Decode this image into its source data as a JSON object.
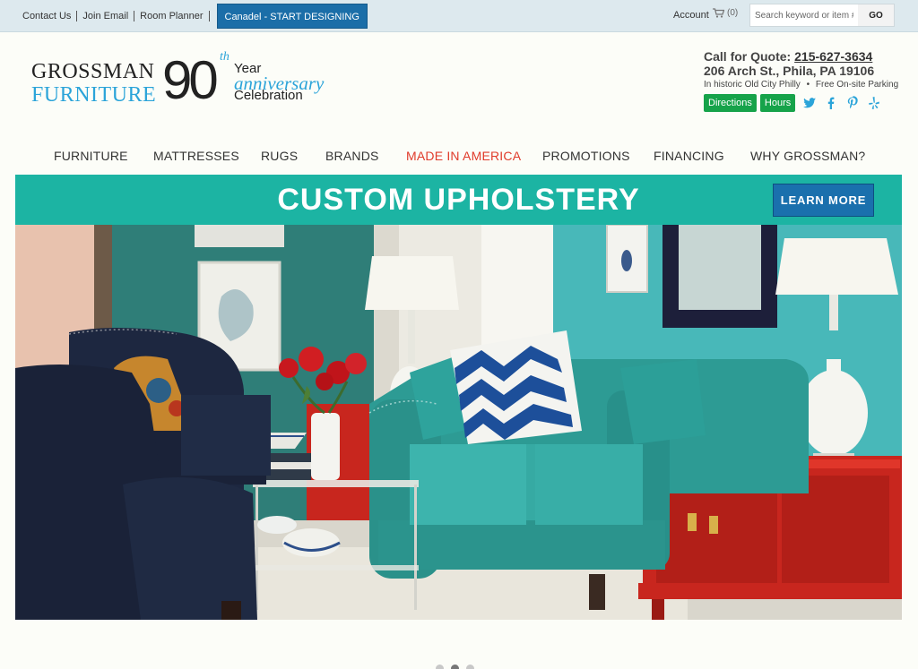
{
  "topbar": {
    "links": [
      "Contact Us",
      "Join Email",
      "Room Planner"
    ],
    "canadel_button": "Canadel - START DESIGNING",
    "account": "Account",
    "cart_count": "(0)",
    "search_placeholder": "Search keyword or item #",
    "go_label": "GO"
  },
  "logo": {
    "line1": "GROSSMAN",
    "line2": "FURNITURE",
    "number": "90",
    "th": "th",
    "year": "Year",
    "anniversary": "anniversary",
    "celebration": "Celebration"
  },
  "contact": {
    "quote_label": "Call for Quote:",
    "phone": "215-627-3634",
    "address": "206 Arch St., Phila, PA 19106",
    "subline_left": "In historic Old City Philly",
    "subline_sep": "•",
    "subline_right": "Free On-site Parking",
    "directions_label": "Directions",
    "hours_label": "Hours",
    "social_icons": [
      "twitter-icon",
      "facebook-icon",
      "pinterest-icon",
      "yelp-icon"
    ]
  },
  "nav": {
    "items": [
      "FURNITURE",
      "MATTRESSES",
      "RUGS",
      "BRANDS",
      "MADE IN AMERICA",
      "PROMOTIONS",
      "FINANCING",
      "WHY GROSSMAN?"
    ],
    "highlight_color": "#e03a2a"
  },
  "banner": {
    "title": "CUSTOM UPHOLSTERY",
    "button_label": "LEARN MORE",
    "bg_color": "#1cb4a3"
  },
  "carousel": {
    "slide_count": 3,
    "active_index": 1
  },
  "colors": {
    "accent_blue": "#1b6ea8",
    "logo_blue": "#2ba4d9",
    "green_button": "#16a34a"
  }
}
